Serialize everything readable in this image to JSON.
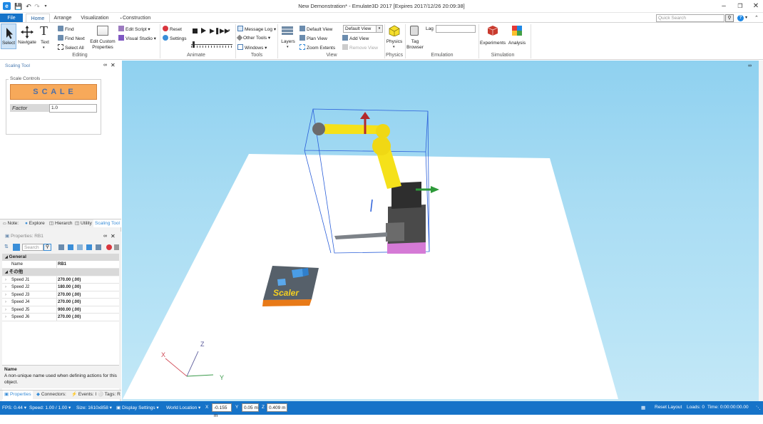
{
  "window": {
    "title": "New Demonstration* - Emulate3D 2017 [Expires 2017/12/26 20:09:38]"
  },
  "tabs": [
    "File",
    "Home",
    "Arrange",
    "Visualization",
    "Construction"
  ],
  "search": {
    "placeholder": "Quick Search"
  },
  "ribbon": {
    "select": "Select",
    "navigate": "Navigate",
    "text": "Text",
    "find": "Find",
    "find_next": "Find Next",
    "select_all": "Select All",
    "edit_custom": "Edit Custom",
    "properties": "Properties",
    "edit_script": "Edit Script",
    "visual_studio": "Visual Studio",
    "editing": "Editing",
    "reset": "Reset",
    "settings": "Settings",
    "animate": "Animate",
    "message_log": "Message Log",
    "other_tools": "Other Tools",
    "windows": "Windows",
    "tools": "Tools",
    "layers": "Layers",
    "default_view": "Default View",
    "plan_view": "Plan View",
    "zoom_extents": "Zoom Extents",
    "view_select": "Default View",
    "add_view": "Add View",
    "remove_view": "Remove View",
    "view": "View",
    "physics": "Physics",
    "physics_group": "Physics",
    "tag": "Tag",
    "browser": "Browser",
    "lag": "Lag",
    "emulation": "Emulation",
    "experiments": "Experiments",
    "analysis": "Analysis",
    "simulation": "Simulation"
  },
  "scaling_tool": {
    "title": "Scaling Tool",
    "group": "Scale Controls",
    "button": "S C A L E",
    "factor_label": "Factor",
    "factor_value": "1.0"
  },
  "dock_tabs": [
    "Note:",
    "Explore",
    "Hierarch",
    "Utility",
    "Scaling Tool"
  ],
  "properties": {
    "title": "Properties: RB1",
    "search_placeholder": "Search",
    "general": "General",
    "name_label": "Name",
    "name_value": "RB1",
    "other": "その他",
    "rows": [
      {
        "k": "Speed J1",
        "v": "270.00 (.00)"
      },
      {
        "k": "Speed J2",
        "v": "180.00 (.00)"
      },
      {
        "k": "Speed J3",
        "v": "270.00 (.00)"
      },
      {
        "k": "Speed J4",
        "v": "270.00 (.00)"
      },
      {
        "k": "Speed J5",
        "v": "900.00 (.00)"
      },
      {
        "k": "Speed J6",
        "v": "270.00 (.00)"
      }
    ],
    "desc_title": "Name",
    "desc_text": "A non-unique name used when defining actions for this object."
  },
  "bottom_tabs": [
    "Properties",
    "Connectors:",
    "Events: I",
    "Tags: R"
  ],
  "scene": {
    "scaler_label": "Scaler",
    "axis_z": "Z",
    "axis_x": "X",
    "axis_y": "Y"
  },
  "status": {
    "fps": "FPS: 0.44",
    "speed": "Speed: 1.00 / 1.00",
    "size": "Size: 1610x858",
    "display": "Display Settings",
    "world": "World Location",
    "x_label": "X",
    "x_val": "-0.155 m",
    "y_label": "Y",
    "y_val": "0.05 m",
    "z_label": "Z",
    "z_val": "0.409 m",
    "reset_layout": "Reset Layout",
    "loads": "Loads: 0",
    "time": "Time: 0:00:00:00.00"
  },
  "colors": {
    "accent": "#1673c8",
    "robot": "#f5e11a",
    "scale_btn": "#f7a95a"
  }
}
